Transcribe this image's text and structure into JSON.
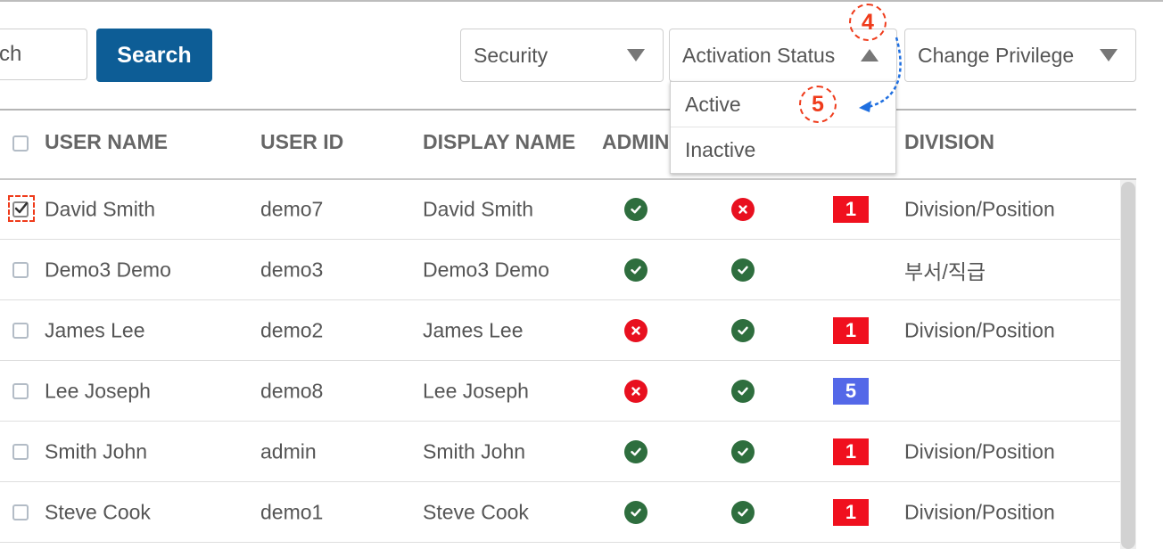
{
  "toolbar": {
    "search_value": "ch",
    "search_button": "Search",
    "security_dropdown": "Security",
    "activation_dropdown": "Activation Status",
    "privilege_dropdown": "Change Privilege"
  },
  "activation_menu": {
    "options": [
      "Active",
      "Inactive"
    ]
  },
  "annotations": {
    "step4": "4",
    "step5": "5"
  },
  "table": {
    "headers": {
      "user_name": "USER NAME",
      "user_id": "USER ID",
      "display_name": "DISPLAY NAME",
      "admin": "ADMIN",
      "division": "DIVISION"
    },
    "rows": [
      {
        "name": "David Smith",
        "id": "demo7",
        "display": "David Smith",
        "admin": "check",
        "active": "x",
        "badge": "1",
        "badge_color": "#f0101e",
        "division": "Division/Position",
        "checked": true
      },
      {
        "name": "Demo3 Demo",
        "id": "demo3",
        "display": "Demo3 Demo",
        "admin": "check",
        "active": "check",
        "badge": "",
        "badge_color": "",
        "division": "부서/직급",
        "checked": false
      },
      {
        "name": "James Lee",
        "id": "demo2",
        "display": "James Lee",
        "admin": "x",
        "active": "check",
        "badge": "1",
        "badge_color": "#f0101e",
        "division": "Division/Position",
        "checked": false
      },
      {
        "name": "Lee Joseph",
        "id": "demo8",
        "display": "Lee Joseph",
        "admin": "x",
        "active": "check",
        "badge": "5",
        "badge_color": "#5468e8",
        "division": "",
        "checked": false
      },
      {
        "name": "Smith John",
        "id": "admin",
        "display": "Smith John",
        "admin": "check",
        "active": "check",
        "badge": "1",
        "badge_color": "#f0101e",
        "division": "Division/Position",
        "checked": false
      },
      {
        "name": "Steve Cook",
        "id": "demo1",
        "display": "Steve Cook",
        "admin": "check",
        "active": "check",
        "badge": "1",
        "badge_color": "#f0101e",
        "division": "Division/Position",
        "checked": false
      }
    ]
  },
  "colors": {
    "primary": "#0d5d96",
    "check_green": "#2e6e3e",
    "error_red": "#e8101f",
    "annotation_red": "#ef3b1b",
    "arrow_blue": "#1f6fe0"
  }
}
